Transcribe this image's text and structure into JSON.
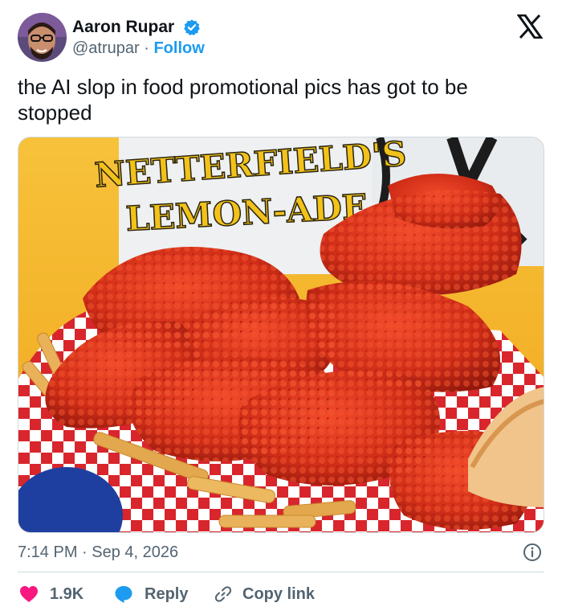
{
  "author": {
    "name": "Aaron Rupar",
    "handle": "@atrupar",
    "separator": "·",
    "follow_label": "Follow",
    "verified_icon": "verified-badge-icon",
    "avatar": "profile-photo"
  },
  "platform_logo": "x-logo-icon",
  "tweet": {
    "text": "the AI slop in food promotional pics has got to be stopped",
    "timestamp": "7:14 PM · Sep 4, 2026"
  },
  "media": {
    "description_icon": "food-photo",
    "cup_text_line1": "NETTERFIELD'S",
    "cup_text_line2": "LEMON-ADE"
  },
  "actions": {
    "like_count": "1.9K",
    "reply_label": "Reply",
    "copy_label": "Copy link",
    "info_icon": "info-icon"
  },
  "colors": {
    "link_blue": "#1d9bf0",
    "like_red": "#f91880",
    "reply_blue": "#1d9bf0",
    "muted_gray": "#536471",
    "text_dark": "#0f1419"
  }
}
